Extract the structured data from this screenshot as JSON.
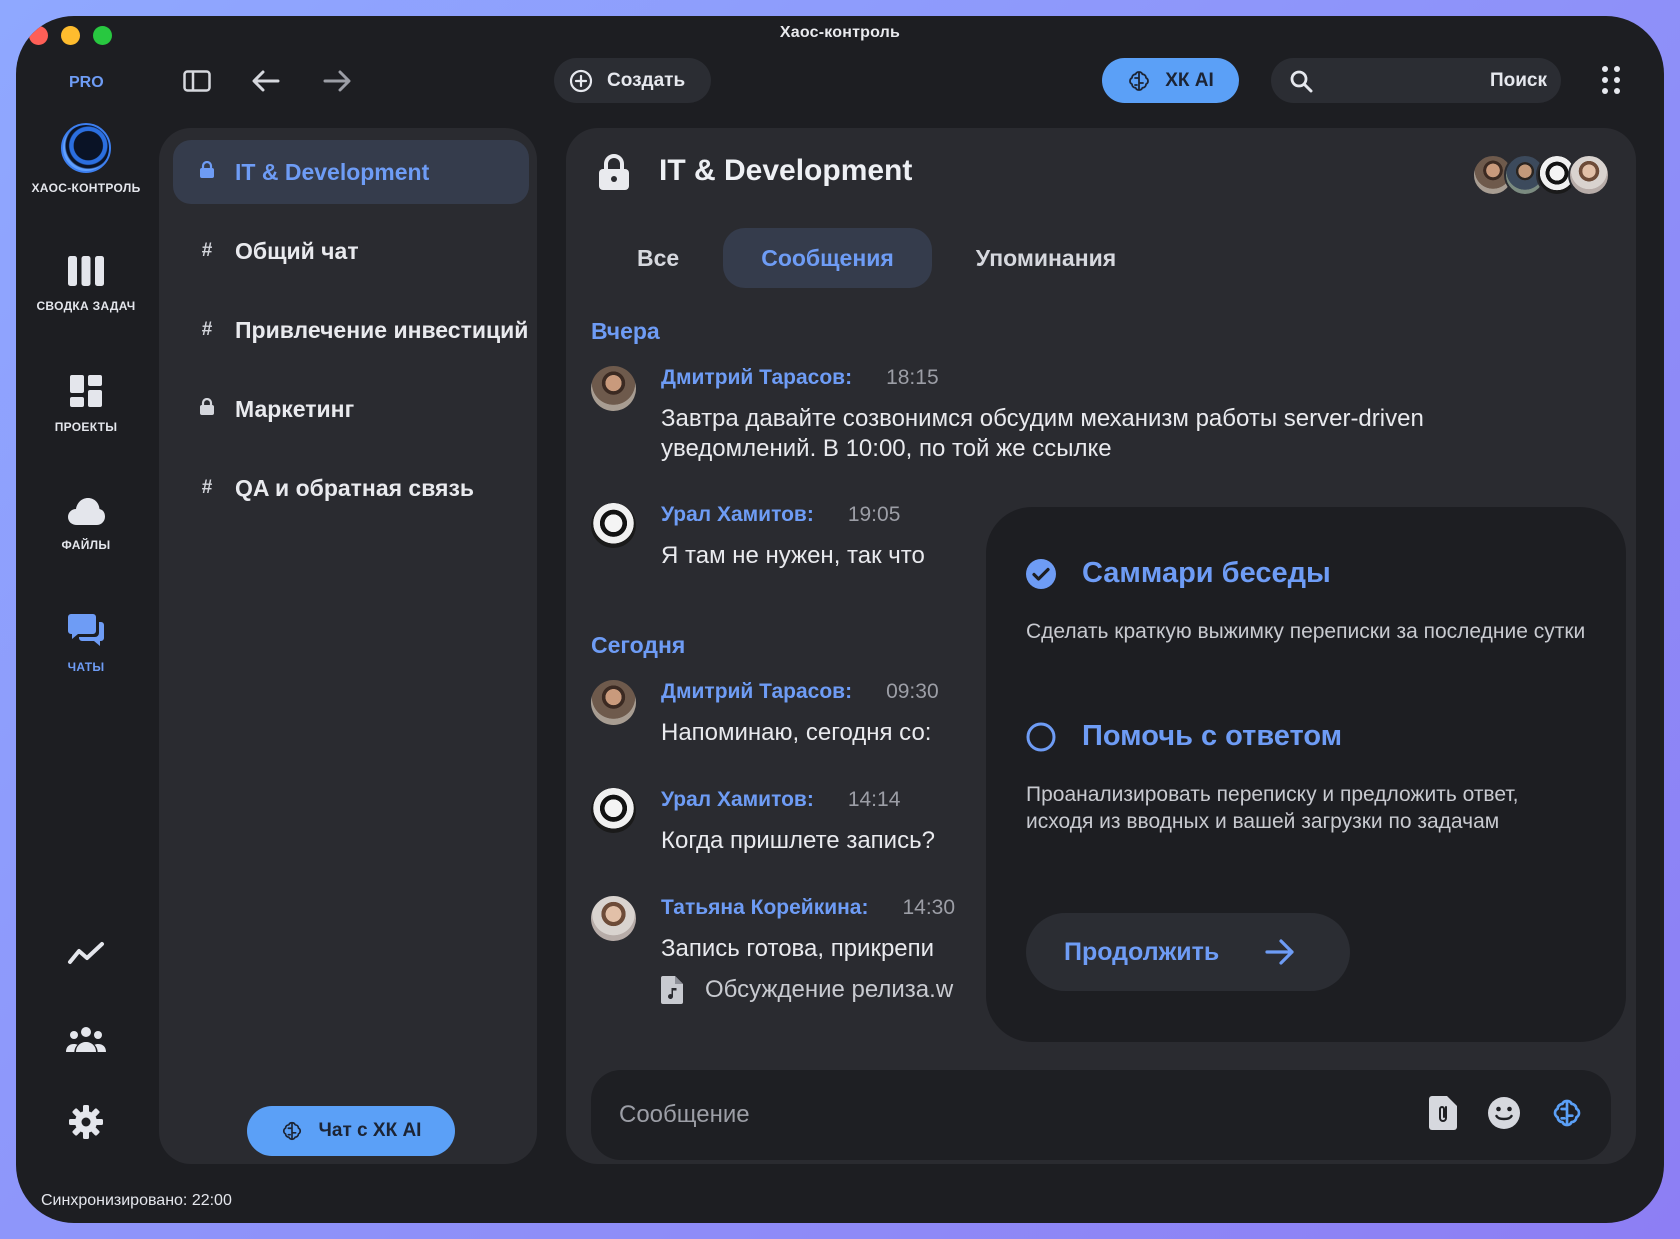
{
  "window": {
    "title": "Хаос-контроль"
  },
  "toolbar": {
    "plan_badge": "PRO",
    "create_label": "Создать",
    "ai_label": "ХК AI",
    "search_label": "Поиск"
  },
  "rail": {
    "logo_label": "ХАОС-КОНТРОЛЬ",
    "items": [
      {
        "label": "СВОДКА ЗАДАЧ",
        "icon": "bars-icon"
      },
      {
        "label": "ПРОЕКТЫ",
        "icon": "dashboard-icon"
      },
      {
        "label": "ФАЙЛЫ",
        "icon": "cloud-icon"
      },
      {
        "label": "ЧАТЫ",
        "icon": "chat-icon",
        "active": true
      }
    ],
    "bottom_icons": [
      "analytics-icon",
      "team-icon",
      "settings-icon"
    ]
  },
  "channels": {
    "items": [
      {
        "label": "IT & Development",
        "type": "private",
        "active": true
      },
      {
        "label": "Общий чат",
        "type": "public"
      },
      {
        "label": "Привлечение инвестиций",
        "type": "public"
      },
      {
        "label": "Маркетинг",
        "type": "private"
      },
      {
        "label": "QA и обратная связь",
        "type": "public"
      }
    ],
    "ai_chat_label": "Чат с ХК AI"
  },
  "status": {
    "sync_text": "Синхронизировано: 22:00"
  },
  "main": {
    "title": "IT & Development",
    "tabs": [
      {
        "label": "Все"
      },
      {
        "label": "Сообщения",
        "active": true
      },
      {
        "label": "Упоминания"
      }
    ],
    "days": [
      "Вчера",
      "Сегодня"
    ],
    "messages": [
      {
        "author": "Дмитрий Тарасов:",
        "time": "18:15",
        "text": "Завтра давайте созвонимся обсудим механизм работы server-driven уведомлений. В 10:00, по той же ссылке"
      },
      {
        "author": "Урал Хамитов:",
        "time": "19:05",
        "text": "Я там не нужен, так что"
      },
      {
        "author": "Дмитрий Тарасов:",
        "time": "09:30",
        "text": "Напоминаю, сегодня со:"
      },
      {
        "author": "Урал Хамитов:",
        "time": "14:14",
        "text": "Когда пришлете запись?"
      },
      {
        "author": "Татьяна Корейкина:",
        "time": "14:30",
        "text": "Запись готова, прикрепи",
        "attachment": "Обсуждение релиза.w"
      }
    ],
    "composer_placeholder": "Сообщение"
  },
  "ai_popover": {
    "options": [
      {
        "title": "Саммари беседы",
        "description": "Сделать краткую выжимку переписки за последние сутки",
        "selected": true
      },
      {
        "title": "Помочь с ответом",
        "description": "Проанализировать переписку и предложить ответ, исходя из вводных и вашей загрузки по задачам",
        "selected": false
      }
    ],
    "continue_label": "Продолжить"
  },
  "colors": {
    "accent": "#6e9cf5",
    "button_blue": "#5ba0f7",
    "panel": "#2a2b30",
    "background": "#1d1e22",
    "frame": "#8d9af6"
  }
}
